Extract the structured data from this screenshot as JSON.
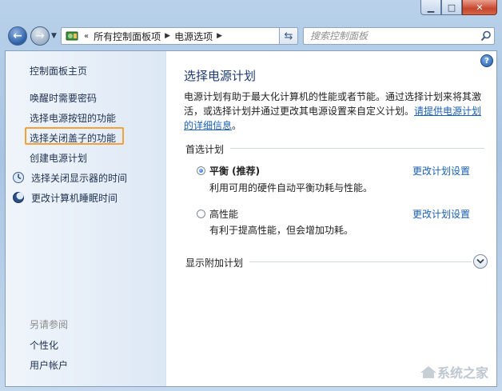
{
  "window": {
    "minimize_icon": "minimize-icon",
    "maximize_icon": "maximize-icon",
    "close_icon": "close-icon"
  },
  "toolbar": {
    "address": {
      "overflow": "«",
      "crumbs": [
        "所有控制面板项",
        "电源选项"
      ]
    },
    "search": {
      "placeholder": "搜索控制面板"
    }
  },
  "sidebar": {
    "home": "控制面板主页",
    "links": [
      "唤醒时需要密码",
      "选择电源按钮的功能",
      "选择关闭盖子的功能",
      "创建电源计划",
      "选择关闭显示器的时间",
      "更改计算机睡眠时间"
    ],
    "see_also_heading": "另请参阅",
    "see_also": [
      "个性化",
      "用户帐户"
    ]
  },
  "main": {
    "title": "选择电源计划",
    "desc_line1": "电源计划有助于最大化计算机的性能或者节能。通过选择计划来将其激",
    "desc_line2_text": "活，或选择计划并通过更改其电源设置来自定义计划。",
    "desc_link_a": "请提供电源计划",
    "desc_link_b": "的详细信息",
    "desc_end": "。",
    "section": "首选计划",
    "plans": [
      {
        "name": "平衡 (推荐)",
        "desc": "利用可用的硬件自动平衡功耗与性能。",
        "link": "更改计划设置",
        "selected": true
      },
      {
        "name": "高性能",
        "desc": "有利于提高性能，但会增加功耗。",
        "link": "更改计划设置",
        "selected": false
      }
    ],
    "more": "显示附加计划"
  },
  "watermark": "系统之家"
}
